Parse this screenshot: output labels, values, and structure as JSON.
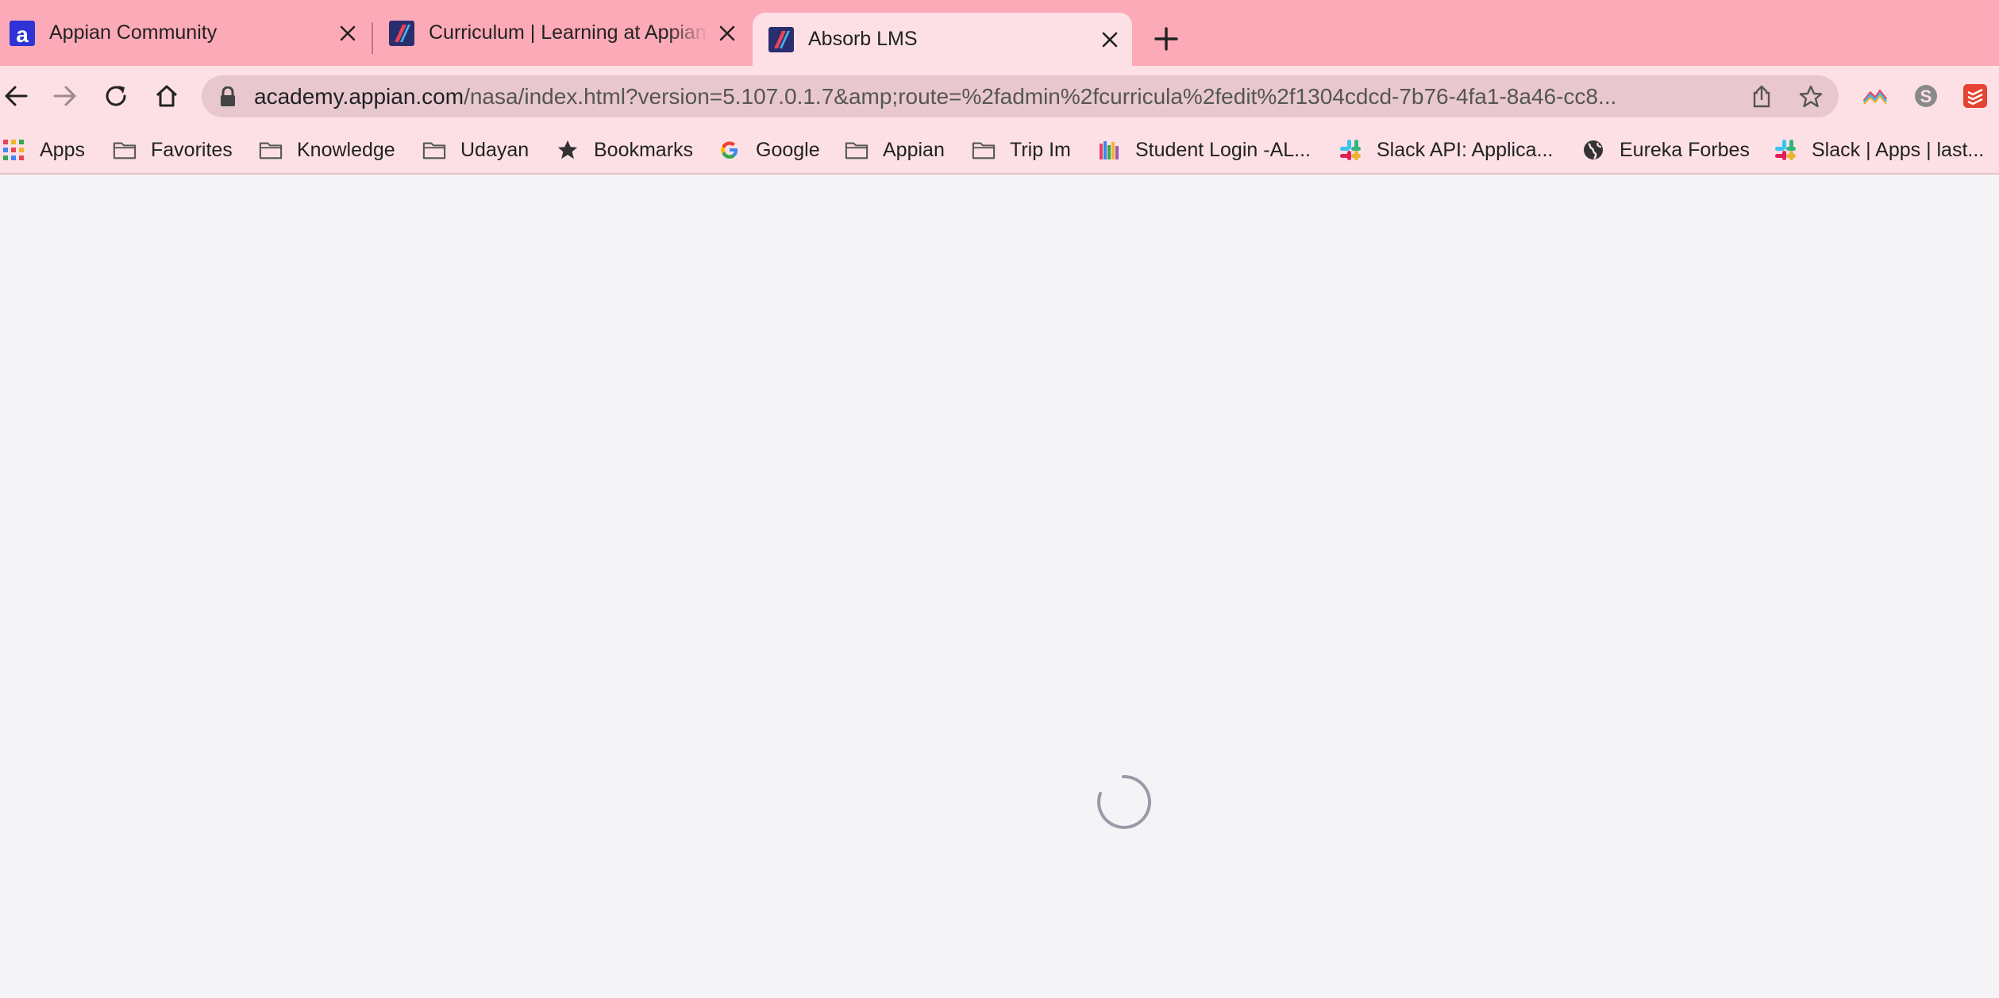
{
  "tabs": [
    {
      "title": "Appian Community",
      "icon": "appian-community-favicon",
      "active": false
    },
    {
      "title": "Curriculum | Learning at Appian",
      "icon": "absorb-favicon",
      "active": false
    },
    {
      "title": "Absorb LMS",
      "icon": "absorb-favicon",
      "active": true
    }
  ],
  "new_tab_icon": "plus-icon",
  "address_bar": {
    "host": "academy.appian.com",
    "path": "/nasa/index.html?version=5.107.0.1.7&amp;route=%2fadmin%2fcurricula%2fedit%2f1304cdcd-7b76-4fa1-8a46-cc8..."
  },
  "bookmarks": [
    {
      "label": "Apps",
      "icon": "apps-grid-icon"
    },
    {
      "label": "Favorites",
      "icon": "folder-icon"
    },
    {
      "label": "Knowledge",
      "icon": "folder-icon"
    },
    {
      "label": "Udayan",
      "icon": "folder-icon"
    },
    {
      "label": "Bookmarks",
      "icon": "star-icon"
    },
    {
      "label": "Google",
      "icon": "google-icon"
    },
    {
      "label": "Appian",
      "icon": "folder-icon"
    },
    {
      "label": "Trip Im",
      "icon": "folder-icon"
    },
    {
      "label": "Student Login -AL...",
      "icon": "books-icon"
    },
    {
      "label": "Slack API: Applica...",
      "icon": "slack-icon"
    },
    {
      "label": "Eureka Forbes",
      "icon": "globe-icon"
    },
    {
      "label": "Slack | Apps | last...",
      "icon": "slack-icon"
    }
  ],
  "colors": {
    "tabstrip": "#fdaab8",
    "toolbar": "#fde0e6",
    "omnibox": "#e8c8ce",
    "content": "#f4f4f6",
    "spinner": "#9a9aa8"
  }
}
